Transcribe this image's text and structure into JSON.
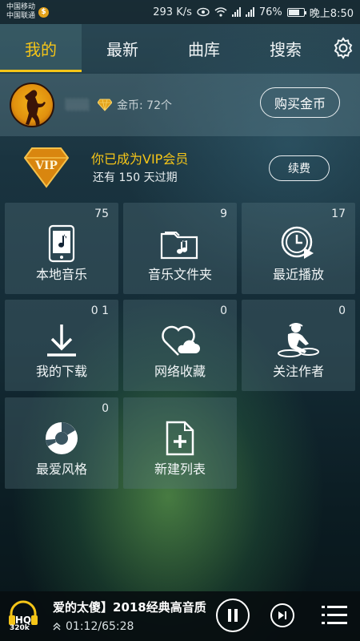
{
  "status_bar": {
    "carrier_1": "中国移动",
    "carrier_2": "中国联通",
    "net_speed": "293 K/s",
    "battery": "76%",
    "battery_level": 0.76,
    "time": "晚上8:50"
  },
  "tabs": [
    {
      "label": "我的",
      "active": true
    },
    {
      "label": "最新",
      "active": false
    },
    {
      "label": "曲库",
      "active": false
    },
    {
      "label": "搜索",
      "active": false
    }
  ],
  "profile": {
    "coins": "金币: 72个",
    "buy_label": "购买金币"
  },
  "vip": {
    "badge_text": "VIP",
    "title": "你已成为VIP会员",
    "subtitle": "还有 150 天过期",
    "renew_label": "续费"
  },
  "tiles": [
    {
      "label": "本地音乐",
      "count": "75",
      "icon": "phone-music-icon"
    },
    {
      "label": "音乐文件夹",
      "count": "9",
      "icon": "music-folder-icon"
    },
    {
      "label": "最近播放",
      "count": "17",
      "icon": "recent-play-icon"
    },
    {
      "label": "我的下载",
      "count": "0 1",
      "icon": "download-icon"
    },
    {
      "label": "网络收藏",
      "count": "0",
      "icon": "cloud-heart-icon"
    },
    {
      "label": "关注作者",
      "count": "0",
      "icon": "dj-icon"
    },
    {
      "label": "最爱风格",
      "count": "0",
      "icon": "style-disc-icon"
    },
    {
      "label": "新建列表",
      "count": "",
      "icon": "new-list-icon"
    }
  ],
  "player": {
    "quality": "HQ",
    "bitrate": "320k",
    "song_title": "爱的太傻】2018经典高音质",
    "time": "01:12/65:28"
  },
  "colors": {
    "accent": "#f5c518",
    "tile_bg": "#5a7882"
  }
}
